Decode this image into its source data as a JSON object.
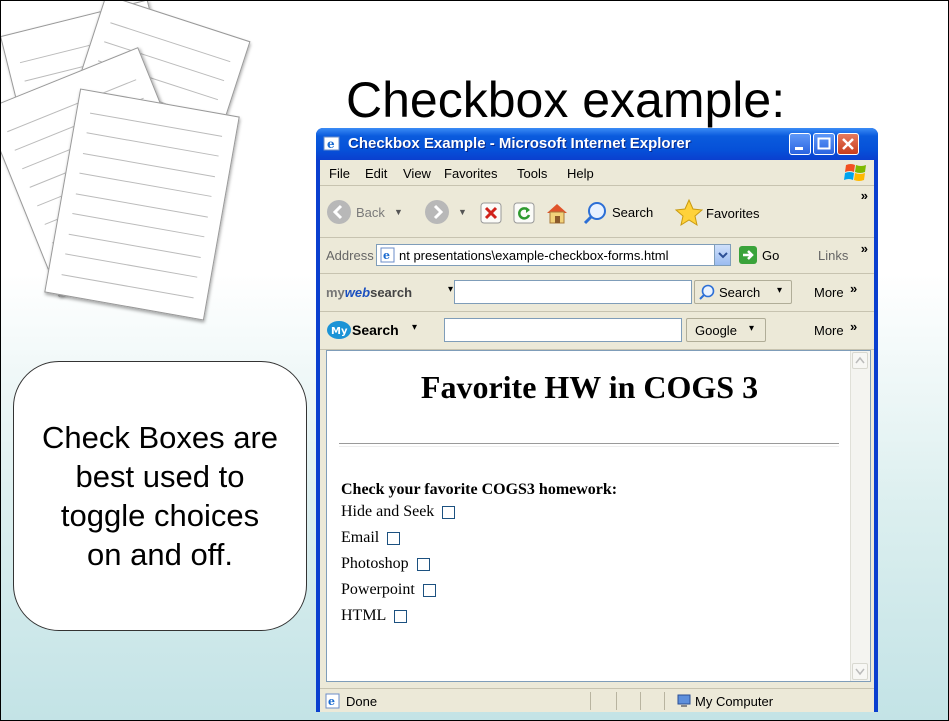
{
  "slide": {
    "title": "Checkbox example:",
    "callout": "Check Boxes are best used to toggle choices on and off."
  },
  "window": {
    "title": "Checkbox Example - Microsoft Internet Explorer",
    "menu": [
      "File",
      "Edit",
      "View",
      "Favorites",
      "Tools",
      "Help"
    ],
    "toolbar": {
      "back": "Back",
      "search": "Search",
      "favorites": "Favorites"
    },
    "address": {
      "label": "Address",
      "value": "nt presentations\\example-checkbox-forms.html",
      "go": "Go",
      "links": "Links"
    },
    "websearch_bar": {
      "brand_my": "my",
      "brand_web": "web",
      "brand_search": "search",
      "search_button": "Search",
      "more": "More"
    },
    "mysearch_bar": {
      "brand_my": "My",
      "brand_search": "Search",
      "engine": "Google",
      "more": "More"
    },
    "status": {
      "text": "Done",
      "zone": "My Computer"
    }
  },
  "page": {
    "heading": "Favorite HW in COGS 3",
    "prompt": "Check your favorite COGS3 homework:",
    "options": [
      "Hide and Seek",
      "Email",
      "Photoshop",
      "Powerpoint",
      "HTML"
    ]
  },
  "colors": {
    "title_bar": "#0a5bdd",
    "close_button": "#c73d1d",
    "gradient_bottom": "#c3e3e6"
  }
}
